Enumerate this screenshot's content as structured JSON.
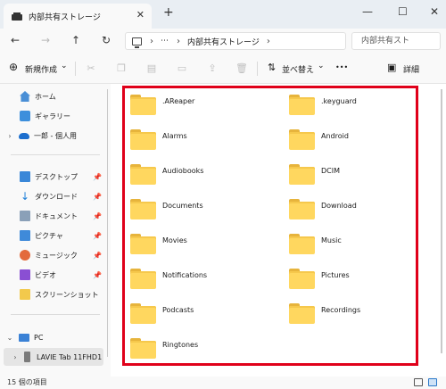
{
  "window": {
    "tab_title": "内部共有ストレージ",
    "close_tab": "✕",
    "new_tab": "+",
    "minimize": "—",
    "maximize": "☐",
    "close": "✕"
  },
  "nav": {
    "back": "←",
    "forward": "→",
    "up": "↑",
    "refresh": "↻",
    "chevron": "›",
    "ellipsis": "⋯"
  },
  "address": {
    "crumb": "内部共有ストレージ",
    "search_placeholder": "内部共有スト"
  },
  "commands": {
    "new_label": "新規作成",
    "new_chevron": "⌄",
    "sort_label": "並べ替え",
    "sort_chevron": "⌄",
    "more": "•••",
    "details_label": "詳細"
  },
  "sidebar": {
    "home": "ホーム",
    "gallery": "ギャラリー",
    "onedrive": "一郎 - 個人用",
    "quick": [
      {
        "label": "デスクトップ",
        "icon": "desktop-icon"
      },
      {
        "label": "ダウンロード",
        "icon": "download-icon"
      },
      {
        "label": "ドキュメント",
        "icon": "documents-icon"
      },
      {
        "label": "ピクチャ",
        "icon": "pictures-icon"
      },
      {
        "label": "ミュージック",
        "icon": "music-icon"
      },
      {
        "label": "ビデオ",
        "icon": "videos-icon"
      },
      {
        "label": "スクリーンショット",
        "icon": "folder-icon"
      }
    ],
    "pc": "PC",
    "device": "LAVIE Tab 11FHD1"
  },
  "folders": [
    ".AReaper",
    ".keyguard",
    "Alarms",
    "Android",
    "Audiobooks",
    "DCIM",
    "Documents",
    "Download",
    "Movies",
    "Music",
    "Notifications",
    "Pictures",
    "Podcasts",
    "Recordings",
    "Ringtones"
  ],
  "status": {
    "count": "15 個の項目"
  },
  "colors": {
    "highlight": "#e0001a",
    "folder": "#ffd75f"
  }
}
